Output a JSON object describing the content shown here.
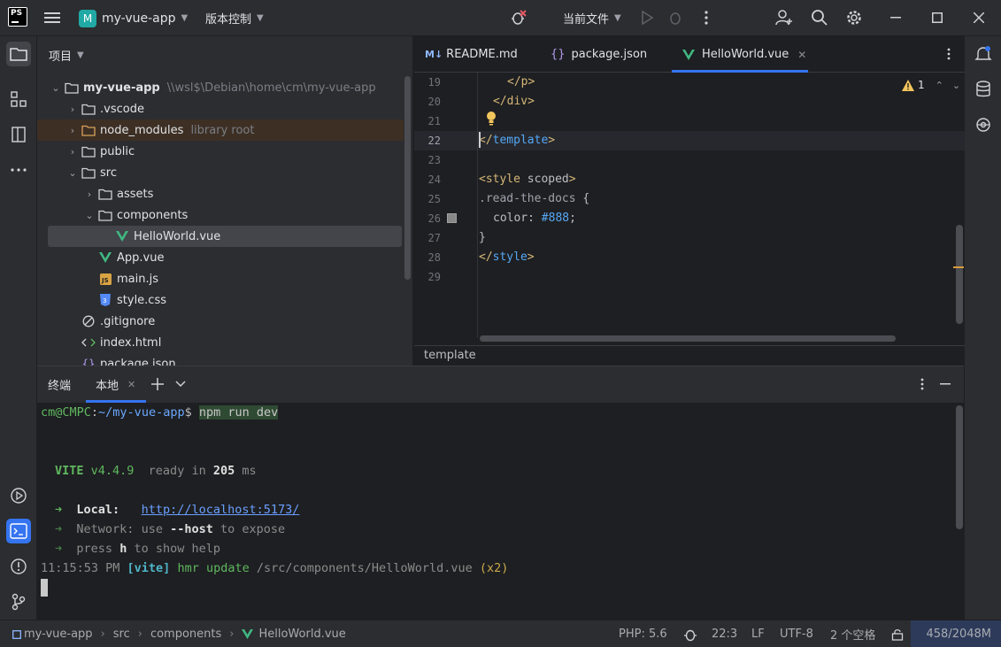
{
  "titlebar": {
    "app_logo": "PS",
    "project_badge": "M",
    "project_name": "my-vue-app",
    "vcs_menu": "版本控制",
    "run_config": "当前文件"
  },
  "project_panel": {
    "title": "项目",
    "tree": [
      {
        "label": "my-vue-app",
        "hint": "\\\\wsl$\\Debian\\home\\cm\\my-vue-app",
        "icon": "folder-icon",
        "expanded": true
      },
      {
        "label": ".vscode",
        "icon": "folder-icon"
      },
      {
        "label": "node_modules",
        "hint": "library root",
        "icon": "folder-icon"
      },
      {
        "label": "public",
        "icon": "folder-icon"
      },
      {
        "label": "src",
        "icon": "folder-icon",
        "expanded": true
      },
      {
        "label": "assets",
        "icon": "folder-icon"
      },
      {
        "label": "components",
        "icon": "folder-icon",
        "expanded": true
      },
      {
        "label": "HelloWorld.vue",
        "icon": "vue-icon",
        "selected": true
      },
      {
        "label": "App.vue",
        "icon": "vue-icon"
      },
      {
        "label": "main.js",
        "icon": "js-icon"
      },
      {
        "label": "style.css",
        "icon": "css-icon"
      },
      {
        "label": ".gitignore",
        "icon": "ignore-icon"
      },
      {
        "label": "index.html",
        "icon": "html-icon"
      },
      {
        "label": "package.json",
        "icon": "json-icon"
      }
    ]
  },
  "editor": {
    "tabs": [
      {
        "label": "README.md",
        "icon": "markdown-icon"
      },
      {
        "label": "package.json",
        "icon": "json-icon"
      },
      {
        "label": "HelloWorld.vue",
        "icon": "vue-icon",
        "active": true
      }
    ],
    "line_numbers": [
      "19",
      "20",
      "21",
      "22",
      "23",
      "24",
      "25",
      "26",
      "27",
      "28",
      "29"
    ],
    "current_line": "22",
    "lines": {
      "l19_open": "</",
      "l19_tag": "p",
      "l19_close": ">",
      "l20_open": "</",
      "l20_tag": "div",
      "l20_close": ">",
      "l22_open": "</",
      "l22_tag": "template",
      "l22_close": ">",
      "l24_open": "<",
      "l24_tag": "style",
      "l24_attr": " scoped",
      "l24_close": ">",
      "l25_selector": ".read-the-docs",
      "l25_brace": " {",
      "l26_prop": "color",
      "l26_colon": ": ",
      "l26_value": "#888",
      "l26_semi": ";",
      "l27": "}",
      "l28_open": "</",
      "l28_tag": "style",
      "l28_close": ">"
    },
    "warnings_count": "1",
    "breadcrumb": "template",
    "color_swatch": "#888888"
  },
  "terminal": {
    "title": "终端",
    "tab_label": "本地",
    "prompt_user": "cm@CMPC",
    "prompt_colon": ":",
    "prompt_path": "~/my-vue-app",
    "prompt_sign": "$ ",
    "command": "npm run dev",
    "vite_label": "VITE",
    "vite_version": " v4.4.9",
    "ready_text": "  ready in ",
    "ready_ms": "205",
    "ready_unit": " ms",
    "arrow": "➜",
    "local_label": "Local:",
    "local_url": "http://localhost:5173/",
    "network_label": "Network:",
    "network_text1": " use ",
    "network_host": "--host",
    "network_text2": " to expose",
    "press_text1": "press ",
    "press_key": "h",
    "press_text2": " to show help",
    "log_time": "11:15:53 PM",
    "log_tag": "[vite]",
    "log_action": "hmr update",
    "log_path": "/src/components/HelloWorld.vue",
    "log_count": "(x2)"
  },
  "statusbar": {
    "crumbs": [
      "my-vue-app",
      "src",
      "components",
      "HelloWorld.vue"
    ],
    "php": "PHP: 5.6",
    "position": "22:3",
    "line_sep": "LF",
    "encoding": "UTF-8",
    "indent": "2 个空格",
    "memory": "458/2048M"
  },
  "colors": {
    "accent": "#3574f0",
    "vue": "#41b883",
    "folder_library": "#d9a05b"
  }
}
